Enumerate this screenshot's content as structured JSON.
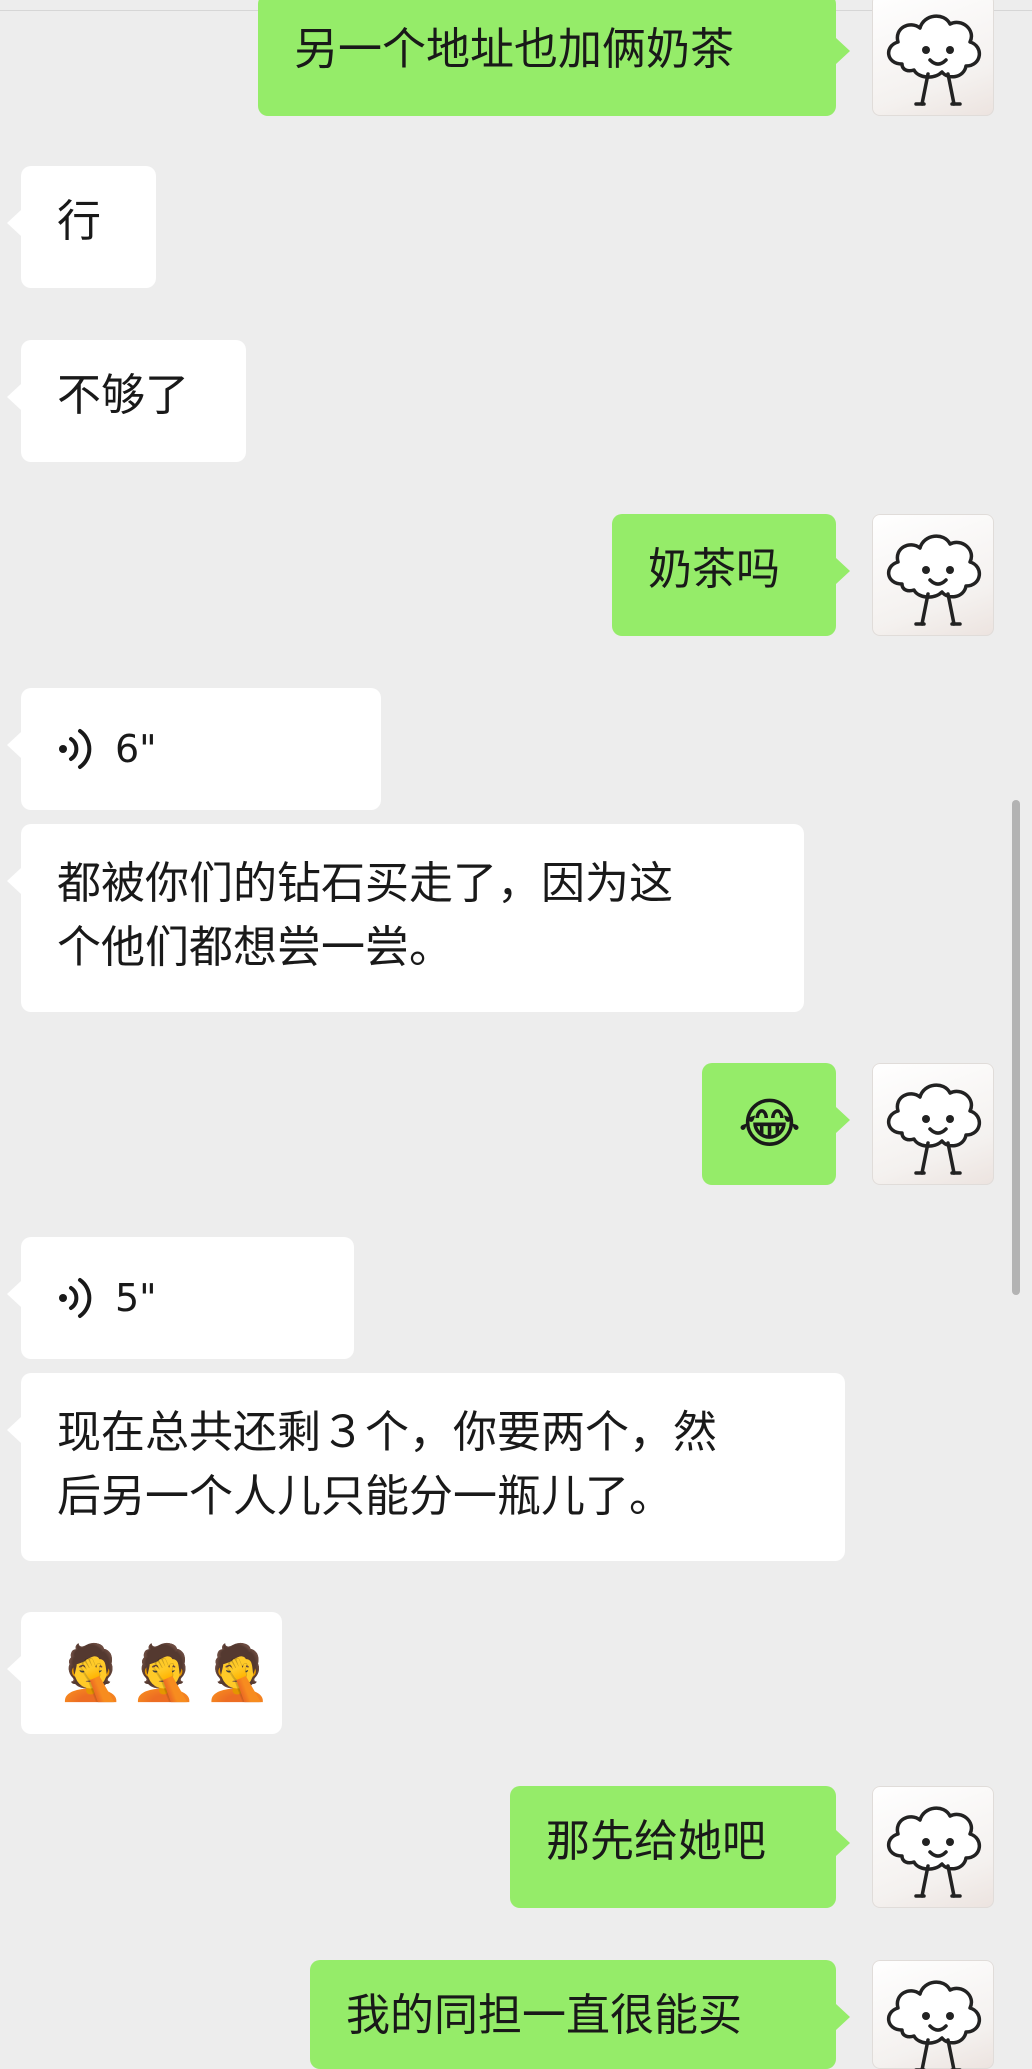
{
  "messages": [
    {
      "id": "m1",
      "side": "out",
      "kind": "text",
      "text": "另一个地址也加俩奶茶"
    },
    {
      "id": "m2",
      "side": "in",
      "kind": "text",
      "text": "行"
    },
    {
      "id": "m3",
      "side": "in",
      "kind": "text",
      "text": "不够了"
    },
    {
      "id": "m4",
      "side": "out",
      "kind": "text",
      "text": "奶茶吗"
    },
    {
      "id": "m5",
      "side": "in",
      "kind": "voice",
      "duration": "6\""
    },
    {
      "id": "m6",
      "side": "in",
      "kind": "text",
      "lines": [
        "都被你们的钻石买走了，因为这",
        "个他们都想尝一尝。"
      ]
    },
    {
      "id": "m7",
      "side": "out",
      "kind": "emoji",
      "emoji": [
        "😂"
      ]
    },
    {
      "id": "m8",
      "side": "in",
      "kind": "voice",
      "duration": "5\""
    },
    {
      "id": "m9",
      "side": "in",
      "kind": "text",
      "lines": [
        "现在总共还剩３个，你要两个，然",
        "后另一个人儿只能分一瓶儿了。"
      ]
    },
    {
      "id": "m10",
      "side": "in",
      "kind": "emoji",
      "emoji": [
        "🤦",
        "🤦",
        "🤦"
      ]
    },
    {
      "id": "m11",
      "side": "out",
      "kind": "text",
      "text": "那先给她吧"
    },
    {
      "id": "m12",
      "side": "out",
      "kind": "text",
      "text": "我的同担一直很能买"
    }
  ],
  "colors": {
    "background": "#ededed",
    "incoming_bubble": "#ffffff",
    "outgoing_bubble": "#95ec69",
    "text": "#191919"
  },
  "icons": {
    "voice": "voice-wave-icon",
    "avatar": "cloud-doodle-avatar",
    "laugh_cry": "face-with-tears-of-joy-emoji",
    "facepalm": "facepalm-emoji"
  }
}
